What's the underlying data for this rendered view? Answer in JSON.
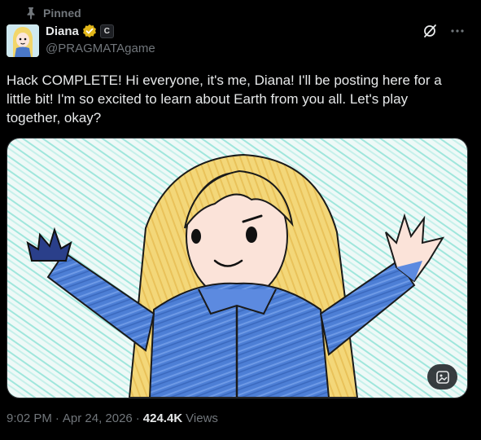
{
  "pinned": {
    "label": "Pinned"
  },
  "author": {
    "display_name": "Diana",
    "handle": "@PRAGMATAgame",
    "affiliate_badge": "C"
  },
  "tweet": {
    "text": "Hack COMPLETE! Hi everyone, it's me, Diana! I'll be posting here for a little bit! I'm so excited to learn about Earth from you all. Let's play together, okay?"
  },
  "meta": {
    "time": "9:02 PM",
    "sep1": "·",
    "date": "Apr 24, 2026",
    "sep2": "·",
    "views_count": "424.4K",
    "views_label": "Views"
  },
  "icons": {
    "pin": "pin-icon",
    "verified": "verified-gold-badge-icon",
    "grok": "grok-icon",
    "more": "more-icon",
    "alt": "alt-text-icon"
  },
  "colors": {
    "background": "#000000",
    "text": "#e7e9ea",
    "muted": "#71767b",
    "verified_gold": "#e2b719"
  }
}
